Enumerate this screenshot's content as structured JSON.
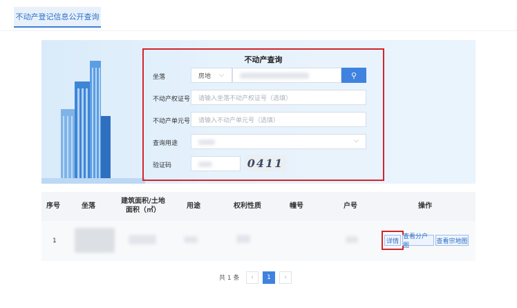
{
  "header": {
    "tab_label": "不动产登记信息公开查询"
  },
  "query": {
    "title": "不动产查询",
    "location_label": "坐落",
    "location_type_selected": "房地",
    "cert_label": "不动产权证号",
    "cert_placeholder": "请输入坐落不动产权证号（选填）",
    "unit_label": "不动产单元号",
    "unit_placeholder": "请输入不动产单元号（选填）",
    "purpose_label": "查询用途",
    "captcha_label": "验证码",
    "captcha_value": "0411"
  },
  "table": {
    "headers": [
      "序号",
      "坐落",
      "建筑面积/土地面积（㎡）",
      "用途",
      "权利性质",
      "幢号",
      "户号",
      "操作"
    ],
    "rows": [
      {
        "index": "1",
        "actions": [
          "详情",
          "查看分户图",
          "查看宗地图"
        ]
      }
    ]
  },
  "pagination": {
    "total_text": "共 1 条",
    "current_page": "1",
    "prev": "‹",
    "next": "›"
  },
  "colors": {
    "accent": "#3f82e0",
    "highlight": "#d2232a"
  }
}
